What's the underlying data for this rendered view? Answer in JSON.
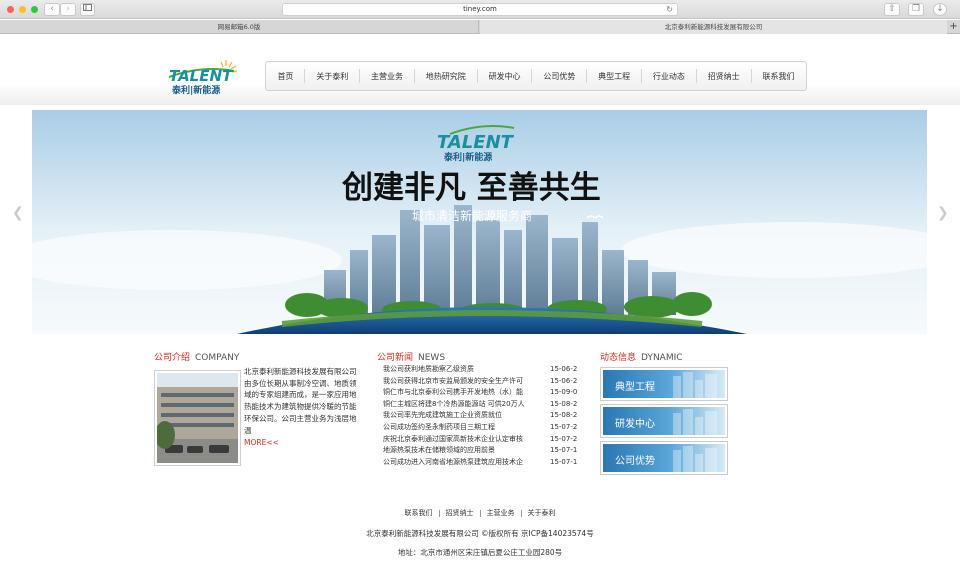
{
  "browser": {
    "url": "tiney.com",
    "tabs": [
      "网易邮箱6.0版",
      "北京泰利新能源科技发展有限公司"
    ]
  },
  "logo": {
    "brand": "TALENT",
    "sub": "泰利|新能源"
  },
  "nav": [
    "首页",
    "关于泰利",
    "主营业务",
    "地热研究院",
    "研发中心",
    "公司优势",
    "典型工程",
    "行业动态",
    "招贤纳士",
    "联系我们"
  ],
  "banner": {
    "slogan": "创建非凡  至善共生",
    "subtitle": "城市清洁新能源服务商"
  },
  "company": {
    "title_cn": "公司介绍",
    "title_en": "COMPANY",
    "text": "北京泰利新能源科技发展有限公司由多位长期从事制冷空调、地质领域的专家组建而成，是一家应用地热能技术为建筑物提供冷暖的节能环保公司。公司主营业务为浅层地温",
    "more": "MORE<<"
  },
  "news": {
    "title_cn": "公司新闻",
    "title_en": "NEWS",
    "items": [
      {
        "title": "我公司获利地质勘察乙级资质",
        "date": "15-06-23"
      },
      {
        "title": "我公司获得北京市安监局颁发的安全生产许可",
        "date": "15-06-22"
      },
      {
        "title": "铜仁市与北京泰利公司携手开发地热（水）能",
        "date": "15-09-01"
      },
      {
        "title": "铜仁主城区将建8个冷热源能源站 可供20万人",
        "date": "15-08-27"
      },
      {
        "title": "我公司率先完成建筑施工企业资质就位",
        "date": "15-08-26"
      },
      {
        "title": "公司成功签约圣永制药项目三期工程",
        "date": "15-07-26"
      },
      {
        "title": "庆祝北京泰利通过国家高新技术企业认定审核",
        "date": "15-07-22"
      },
      {
        "title": "地源热泵技术在储粮领域的应用前景",
        "date": "15-07-17"
      },
      {
        "title": "公司成功进入河南省地源热泵建筑应用技术企",
        "date": "15-07-15"
      }
    ]
  },
  "dynamic": {
    "title_cn": "动态信息",
    "title_en": "DYNAMIC",
    "items": [
      "典型工程",
      "研发中心",
      "公司优势"
    ]
  },
  "footer": {
    "links": [
      "联系我们",
      "招贤纳士",
      "主营业务",
      "关于泰利"
    ],
    "copyright": "北京泰利新能源科技发展有限公司 ©版权所有 京ICP备14023574号",
    "address": "地址：北京市通州区宋庄镇后夏公庄工业园280号"
  },
  "colors": {
    "accent": "#d52b1e",
    "brand_teal": "#1a8fa0",
    "brand_green": "#4aa93c"
  }
}
